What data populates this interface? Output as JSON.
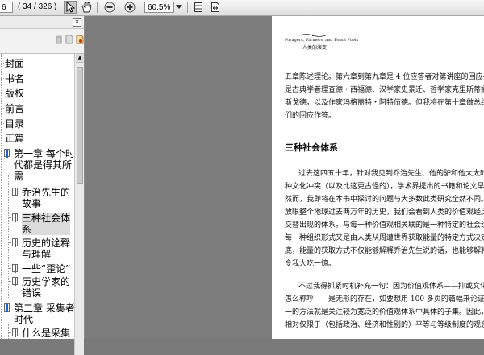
{
  "toolbar": {
    "page_fragment": "6",
    "page_indicator": "( 34 / 326 )",
    "zoom": "60.5%"
  },
  "sidebar": {
    "items": [
      {
        "label": "封面"
      },
      {
        "label": "书名"
      },
      {
        "label": "版权"
      },
      {
        "label": "前言"
      },
      {
        "label": "目录"
      },
      {
        "label": "正篇"
      },
      {
        "label": "第一章 每个时\n代都是得其所\n需"
      },
      {
        "label": "乔治先生的\n故事"
      },
      {
        "label": "三种社会体\n系"
      },
      {
        "label": "历史的诠释\n与理解"
      },
      {
        "label": "一些“歪论”"
      },
      {
        "label": "历史学家的\n错误"
      },
      {
        "label": "第二章 采集者\n时代"
      },
      {
        "label": "什么是采集\n者？"
      }
    ]
  },
  "page": {
    "header_title_en": "Foragers, Farmers, and Fossil Fuels",
    "header_title_cn": "人类的演变",
    "para1": [
      "五章陈述理论。第六章到第九章是 4 位应答者对第讲座的回应——他",
      "是古典学者理查德・西福德、汉学家史景迁、哲学家克里斯蒂娜・M",
      "斯戈德，以及作家玛格丽特・阿特伍德。但我将在第十章做总结而回",
      "们的回应作答。"
    ],
    "heading": "三种社会体系",
    "para2": [
      "过去这四五十年，针对我见到乔治先生、他的驴和他太太时所遭",
      "种文化冲突（以及比这更古怪的），学术界提出的书籍和论文早已堆积",
      "然而，我即将在本书中探讨的问题与大多数此类研究全然不同。在我",
      "放眼整个地球过去两万年的历史，我们会看到人类的价值观经历了三",
      "交替出现的体系。与每一种价值观相关联的是一种特定的社会组织形",
      "每一种组织形式又是由人类从周遭世界获取能量的特定方式决定的。",
      "底，能量的获取方式不仅能够解释乔治先生说的话，也能够解释他和",
      "令我大吃一惊。"
    ],
    "para3": [
      "不过我得抓紧时机补充一句：因为价值观体系——抑或文化，或",
      "怎么称呼——是无形的存在，如要想用 100 多页的篇幅来论证这个问",
      "一的方法就是关注较为宽泛的价值观体系中具体的子集。因此，我在",
      "相对仅限于（包括政治、经济和性别的）平等与等级制度的观念，以及"
    ]
  }
}
